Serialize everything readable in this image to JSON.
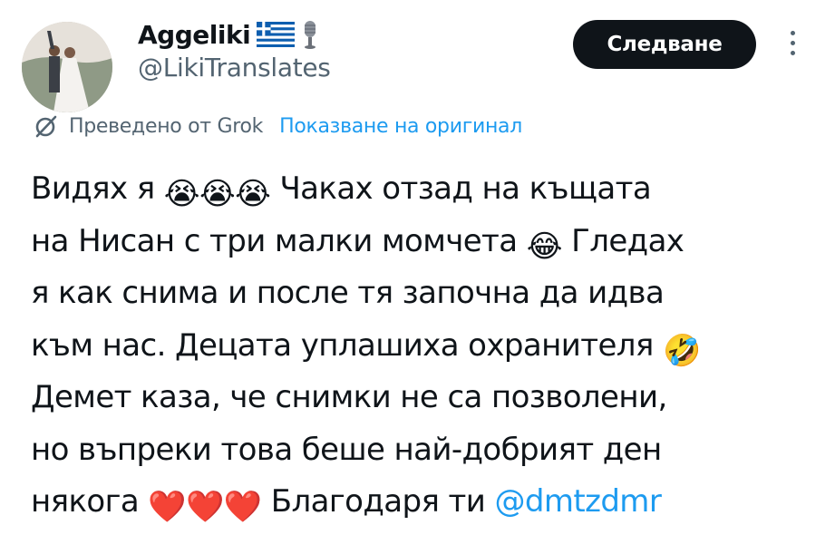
{
  "author": {
    "display_name": "Aggeliki",
    "handle": "@LikiTranslates",
    "flag_icon": "greece-flag-icon",
    "badge_icon": "microphone-icon"
  },
  "follow_button": {
    "label": "Следване"
  },
  "more_menu": {
    "icon": "more-vertical-icon"
  },
  "translation": {
    "icon": "grok-icon",
    "label": "Преведено от Grok",
    "show_original": "Показване на оригинал"
  },
  "tweet": {
    "line1_a": "Видях я",
    "line1_b": "Чаках отзад на къщата",
    "line2_a": "на Нисан с три малки момчета",
    "line2_b": "Гледах",
    "line3": "я как снима и после тя започна да идва",
    "line4_a": "към нас. Децата уплашиха охранителя",
    "line5": "Демет каза, че снимки не са позволени,",
    "line6": "но въпреки това беше най-добрият ден",
    "line7_a": "някога",
    "line7_b": "Благодаря ти",
    "mention": "@dmtzdmr"
  },
  "colors": {
    "text": "#0f1419",
    "secondary": "#536471",
    "link": "#1d9bf0",
    "button_bg": "#0f1419"
  }
}
